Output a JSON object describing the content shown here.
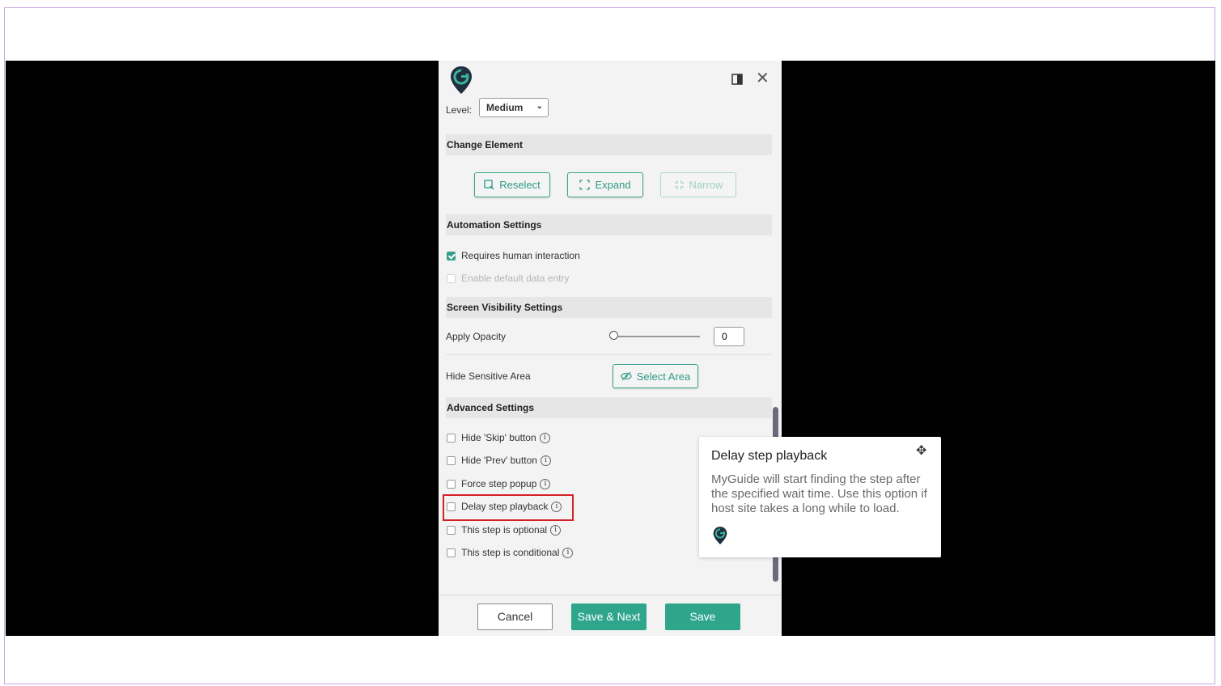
{
  "panel": {
    "level": {
      "label": "Level:",
      "value": "Medium"
    },
    "sections": {
      "change_element": "Change Element",
      "automation": "Automation Settings",
      "screen_visibility": "Screen Visibility Settings",
      "advanced": "Advanced Settings"
    },
    "change_element_buttons": {
      "reselect": "Reselect",
      "expand": "Expand",
      "narrow": "Narrow"
    },
    "automation": {
      "requires_human": {
        "label": "Requires human interaction",
        "checked": true
      },
      "default_data": {
        "label": "Enable default data entry",
        "checked": false,
        "disabled": true
      }
    },
    "visibility": {
      "opacity_label": "Apply Opacity",
      "opacity_value": "0",
      "sensitive_label": "Hide Sensitive Area",
      "select_area": "Select Area"
    },
    "advanced": [
      {
        "label": "Hide 'Skip' button",
        "checked": false
      },
      {
        "label": "Hide 'Prev' button",
        "checked": false
      },
      {
        "label": "Force step popup",
        "checked": false
      },
      {
        "label": "Delay step playback",
        "checked": false
      },
      {
        "label": "This step is optional",
        "checked": false
      },
      {
        "label": "This step is conditional",
        "checked": false
      }
    ],
    "footer": {
      "cancel": "Cancel",
      "save_next": "Save & Next",
      "save": "Save"
    }
  },
  "tooltip": {
    "title": "Delay step playback",
    "body": "MyGuide will start finding the step after the specified wait time. Use this option if host site takes a long while to load."
  },
  "colors": {
    "accent": "#2fa58c",
    "highlight": "#d42027",
    "brand_pin": "#1f2f3f",
    "brand_g": "#3bb59a"
  }
}
